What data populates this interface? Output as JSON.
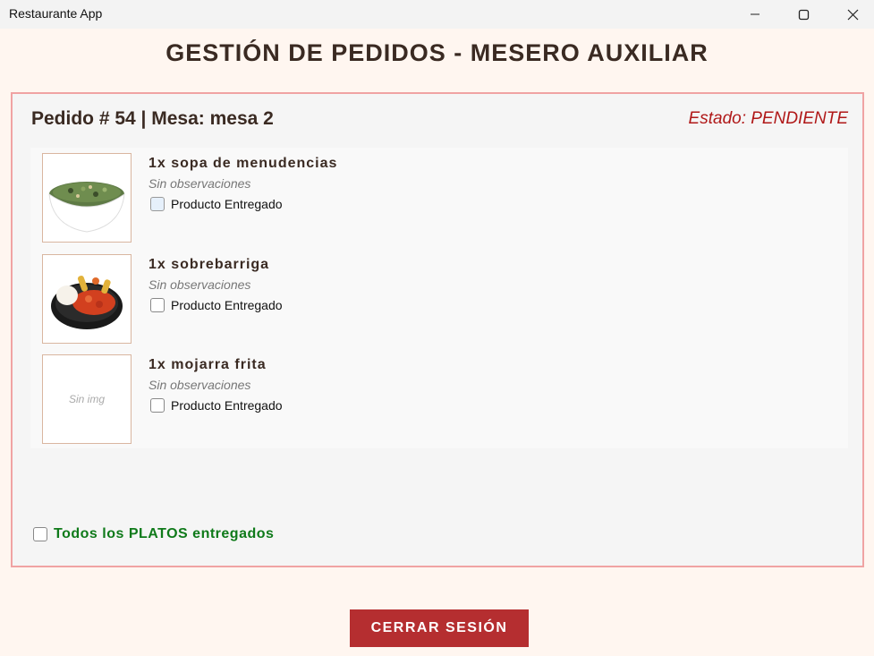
{
  "window": {
    "title": "Restaurante App",
    "controls": [
      "minimize-icon",
      "maximize-icon",
      "close-icon"
    ]
  },
  "page": {
    "title": "GESTIÓN DE PEDIDOS - MESERO AUXILIAR"
  },
  "order": {
    "header": "Pedido # 54 | Mesa: mesa 2",
    "status": "Estado: PENDIENTE",
    "status_color": "#b01818",
    "items": [
      {
        "name": "1x sopa de menudencias",
        "notes": "Sin observaciones",
        "checkbox_label": "Producto Entregado",
        "delivered": false,
        "image": "soup-bowl-image"
      },
      {
        "name": "1x sobrebarriga",
        "notes": "Sin observaciones",
        "checkbox_label": "Producto Entregado",
        "delivered": false,
        "image": "plate-image"
      },
      {
        "name": "1x mojarra frita",
        "notes": "Sin observaciones",
        "checkbox_label": "Producto Entregado",
        "delivered": false,
        "image_placeholder": "Sin img"
      }
    ],
    "all_delivered_label": "Todos los PLATOS entregados",
    "all_delivered_color": "#0f7a1a"
  },
  "footer": {
    "logout_label": "CERRAR SESIÓN",
    "logout_color": "#b52e30"
  }
}
